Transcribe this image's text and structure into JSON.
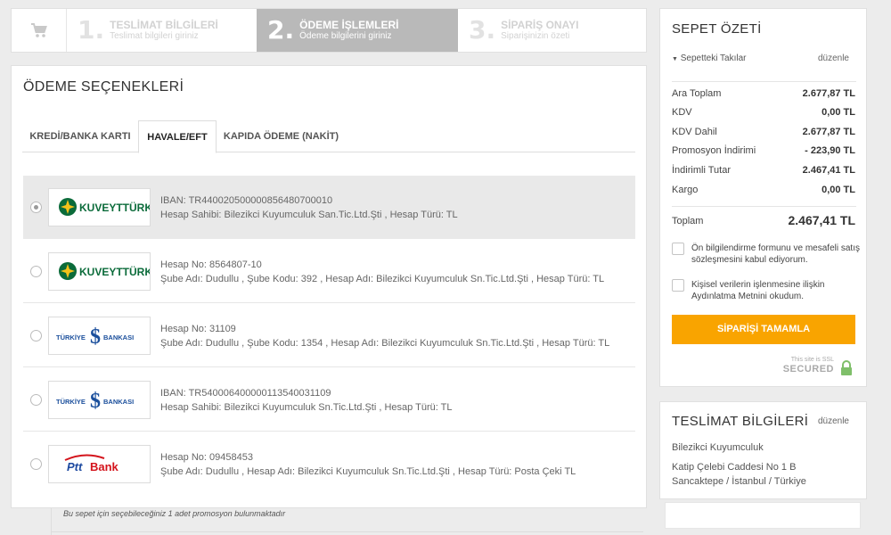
{
  "stepper": {
    "steps": [
      {
        "num": "1.",
        "title": "TESLİMAT BİLGİLERİ",
        "sub": "Teslimat bilgileri giriniz"
      },
      {
        "num": "2.",
        "title": "ÖDEME İŞLEMLERİ",
        "sub": "Ödeme bilgilerini giriniz"
      },
      {
        "num": "3.",
        "title": "SİPARİŞ ONAYI",
        "sub": "Siparişinizin özeti"
      }
    ]
  },
  "payment": {
    "title": "ÖDEME SEÇENEKLERİ",
    "tabs": [
      "KREDİ/BANKA KARTI",
      "HAVALE/EFT",
      "KAPIDA ÖDEME (NAKİT)"
    ],
    "active_tab": "HAVALE/EFT",
    "banks": [
      {
        "logo": "KUVEYTTÜRK",
        "line1": "IBAN: TR440020500000856480700010",
        "line2": "Hesap Sahibi: Bilezikci Kuyumculuk San.Tic.Ltd.Şti , Hesap Türü: TL",
        "selected": true
      },
      {
        "logo": "KUVEYTTÜRK",
        "line1": "Hesap No: 8564807-10",
        "line2": "Şube Adı: Dudullu , Şube Kodu: 392 , Hesap Adı: Bilezikci Kuyumculuk Sn.Tic.Ltd.Şti , Hesap Türü: TL",
        "selected": false
      },
      {
        "logo": "TÜRKİYE İŞ BANKASI",
        "line1": "Hesap No: 31109",
        "line2": "Şube Adı: Dudullu , Şube Kodu: 1354 , Hesap Adı: Bilezikci Kuyumculuk Sn.Tic.Ltd.Şti , Hesap Türü: TL",
        "selected": false
      },
      {
        "logo": "TÜRKİYE İŞ BANKASI",
        "line1": "IBAN: TR540006400000113540031109",
        "line2": "Hesap Sahibi: Bilezikci Kuyumculuk Sn.Tic.Ltd.Şti , Hesap Türü: TL",
        "selected": false
      },
      {
        "logo": "PttBank",
        "line1": "Hesap No: 09458453",
        "line2": "Şube Adı: Dudullu , Hesap Adı: Bilezikci Kuyumculuk Sn.Tic.Ltd.Şti , Hesap Türü: Posta Çeki TL",
        "selected": false
      }
    ],
    "promo_note": "Bu sepet için seçebileceğiniz 1 adet promosyon bulunmaktadır"
  },
  "summary": {
    "title": "SEPET ÖZETİ",
    "toggle_label": "Sepetteki Takılar",
    "edit_label": "düzenle",
    "rows": [
      {
        "label": "Ara Toplam",
        "value": "2.677,87 TL"
      },
      {
        "label": "KDV",
        "value": "0,00 TL"
      },
      {
        "label": "KDV Dahil",
        "value": "2.677,87 TL"
      },
      {
        "label": "Promosyon İndirimi",
        "value": "- 223,90 TL"
      },
      {
        "label": "İndirimli Tutar",
        "value": "2.467,41 TL"
      },
      {
        "label": "Kargo",
        "value": "0,00 TL"
      }
    ],
    "total_label": "Toplam",
    "total_value": "2.467,41 TL",
    "checkbox1": "Ön bilgilendirme formunu ve mesafeli satış sözleşmesini kabul ediyorum.",
    "checkbox2": "Kişisel verilerin işlenmesine ilişkin Aydınlatma Metnini okudum.",
    "order_button": "SİPARİŞİ TAMAMLA",
    "ssl_small": "This site is SSL",
    "ssl_big": "SECURED"
  },
  "delivery": {
    "title": "TESLİMAT BİLGİLERİ",
    "edit_label": "düzenle",
    "name": "Bilezikci Kuyumculuk",
    "address1": "Katip Çelebi Caddesi No 1 B",
    "address2": "Sancaktepe / İstanbul / Türkiye"
  },
  "colors": {
    "accent": "#f9a400",
    "kuveyt_green": "#0b6b3a",
    "isbank_blue": "#1b4f9c",
    "ptt_red": "#d4141c",
    "ptt_blue": "#1e4aa0"
  }
}
